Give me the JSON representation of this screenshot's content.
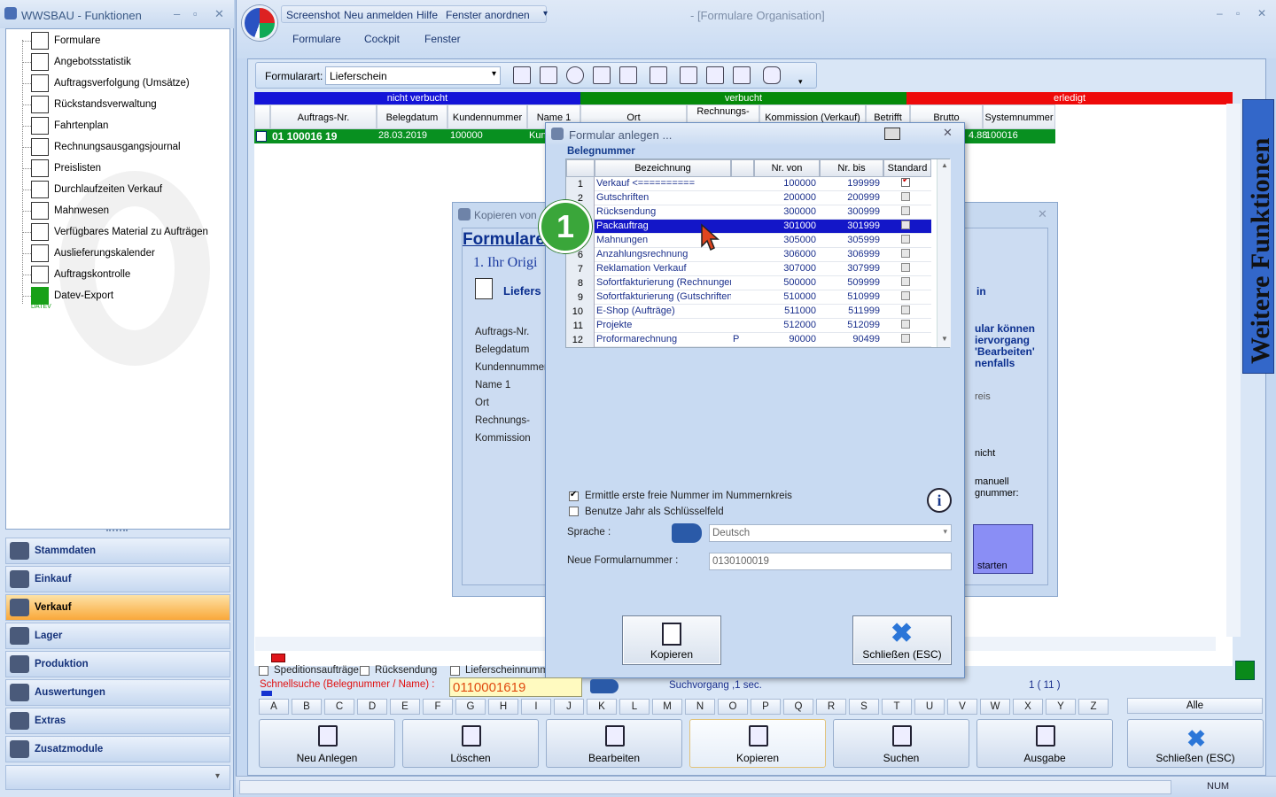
{
  "left_window": {
    "title": "WWSBAU - Funktionen",
    "tree_items": [
      {
        "label": "Formulare",
        "icon": "document-icon"
      },
      {
        "label": "Angebotsstatistik",
        "icon": "statistics-icon"
      },
      {
        "label": "Auftragsverfolgung (Umsätze)",
        "icon": "tracking-icon"
      },
      {
        "label": "Rückstandsverwaltung",
        "icon": "backlog-icon"
      },
      {
        "label": "Fahrtenplan",
        "icon": "truck-icon"
      },
      {
        "label": "Rechnungsausgangsjournal",
        "icon": "journal-icon"
      },
      {
        "label": "Preislisten",
        "icon": "price-tag-icon"
      },
      {
        "label": "Durchlaufzeiten Verkauf",
        "icon": "hourglass-icon"
      },
      {
        "label": "Mahnwesen",
        "icon": "dunning-icon"
      },
      {
        "label": "Verfügbares Material zu Aufträgen",
        "icon": "material-icon"
      },
      {
        "label": "Auslieferungskalender",
        "icon": "calendar-icon"
      },
      {
        "label": "Auftragskontrolle",
        "icon": "control-icon"
      },
      {
        "label": "Datev-Export",
        "icon": "datev-icon"
      }
    ],
    "datev_caption": "DATEV",
    "nav": [
      {
        "label": "Stammdaten",
        "selected": false
      },
      {
        "label": "Einkauf",
        "selected": false
      },
      {
        "label": "Verkauf",
        "selected": true
      },
      {
        "label": "Lager",
        "selected": false
      },
      {
        "label": "Produktion",
        "selected": false
      },
      {
        "label": "Auswertungen",
        "selected": false
      },
      {
        "label": "Extras",
        "selected": false
      },
      {
        "label": "Zusatzmodule",
        "selected": false
      }
    ]
  },
  "main_window": {
    "title": "- [Formulare Organisation]",
    "quick_access": [
      "Screenshot",
      "Neu anmelden",
      "Hilfe",
      "Fenster anordnen"
    ],
    "menu": [
      "Formulare",
      "Cockpit",
      "Fenster"
    ],
    "formularart_label": "Formularart:",
    "formularart_value": "Lieferschein",
    "bands": [
      "nicht verbucht",
      "verbucht",
      "erledigt"
    ],
    "columns": [
      "Auftrags-Nr.",
      "Belegdatum",
      "Kundennummer",
      "Name 1",
      "Ort",
      "Rechnungs-",
      "Kommission (Verkauf)",
      "Betrifft",
      "Brutto",
      "Systemnummer"
    ],
    "row": {
      "auftrag": "01 100016 19",
      "datum": "28.03.2019",
      "kunde": "100000",
      "name": "Kun",
      "brutto": "4.88",
      "system": "100016"
    }
  },
  "kopieren_window": {
    "title": "Kopieren von",
    "heading": "Formulare",
    "section": "1. Ihr Origi",
    "sub": "Liefers",
    "fields": [
      "Auftrags-Nr.",
      "Belegdatum",
      "Kundennummer",
      "Name 1",
      "Ort",
      "Rechnungs-",
      "Kommission"
    ],
    "right_texts": [
      "in",
      "ular können",
      "iervorgang",
      "'Bearbeiten'",
      "nenfalls",
      "reis",
      "nicht",
      "manuell",
      "gnummer:",
      "starten"
    ]
  },
  "dialog": {
    "title": "Formular anlegen ...",
    "section": "Belegnummer",
    "columns": [
      "Bezeichnung",
      "Nr. von",
      "Nr. bis",
      "Standard"
    ],
    "rows": [
      {
        "n": "1",
        "name": "Verkauf  <==========",
        "flag": "",
        "von": "100000",
        "bis": "199999",
        "std": true,
        "sel": false
      },
      {
        "n": "2",
        "name": "Gutschriften",
        "flag": "",
        "von": "200000",
        "bis": "200999",
        "std": false,
        "sel": false
      },
      {
        "n": "3",
        "name": "Rücksendung",
        "flag": "",
        "von": "300000",
        "bis": "300999",
        "std": false,
        "sel": false
      },
      {
        "n": "4",
        "name": "Packauftrag",
        "flag": "",
        "von": "301000",
        "bis": "301999",
        "std": false,
        "sel": true
      },
      {
        "n": "5",
        "name": "Mahnungen",
        "flag": "",
        "von": "305000",
        "bis": "305999",
        "std": false,
        "sel": false
      },
      {
        "n": "6",
        "name": "Anzahlungsrechnung",
        "flag": "",
        "von": "306000",
        "bis": "306999",
        "std": false,
        "sel": false
      },
      {
        "n": "7",
        "name": "Reklamation Verkauf",
        "flag": "",
        "von": "307000",
        "bis": "307999",
        "std": false,
        "sel": false
      },
      {
        "n": "8",
        "name": "Sofortfakturierung (Rechnungen",
        "flag": "",
        "von": "500000",
        "bis": "509999",
        "std": false,
        "sel": false
      },
      {
        "n": "9",
        "name": "Sofortfakturierung (Gutschriften)",
        "flag": "",
        "von": "510000",
        "bis": "510999",
        "std": false,
        "sel": false
      },
      {
        "n": "10",
        "name": "E-Shop (Aufträge)",
        "flag": "",
        "von": "511000",
        "bis": "511999",
        "std": false,
        "sel": false
      },
      {
        "n": "11",
        "name": "Projekte",
        "flag": "",
        "von": "512000",
        "bis": "512099",
        "std": false,
        "sel": false
      },
      {
        "n": "12",
        "name": "Proformarechnung",
        "flag": "P",
        "von": "90000",
        "bis": "90499",
        "std": false,
        "sel": false
      }
    ],
    "check1": "Ermittle erste freie Nummer im Nummernkreis",
    "check1_on": true,
    "check2": "Benutze Jahr als Schlüsselfeld",
    "check2_on": false,
    "sprache_label": "Sprache :",
    "sprache_value": "Deutsch",
    "neue_label": "Neue Formularnummer :",
    "neue_value": "0130100019",
    "btn_kopieren": "Kopieren",
    "btn_close": "Schließen (ESC)"
  },
  "badge": "1",
  "bottom": {
    "checks": [
      "Speditionsaufträge",
      "Rücksendung",
      "Lieferscheinnumme"
    ],
    "search_label": "Schnellsuche (Belegnummer / Name) :",
    "search_value": "0110001619",
    "search_status": "Suchvorgang ,1 sec.",
    "count": "1  ( 11 )",
    "letters": [
      "A",
      "B",
      "C",
      "D",
      "E",
      "F",
      "G",
      "H",
      "I",
      "J",
      "K",
      "L",
      "M",
      "N",
      "O",
      "P",
      "Q",
      "R",
      "S",
      "T",
      "U",
      "V",
      "W",
      "X",
      "Y",
      "Z"
    ],
    "alle": "Alle",
    "actions": [
      "Neu Anlegen",
      "Löschen",
      "Bearbeiten",
      "Kopieren",
      "Suchen",
      "Ausgabe",
      "Schließen (ESC)"
    ]
  },
  "side_panel": "Weitere Funktionen",
  "status": {
    "num": "NUM"
  },
  "colors": {
    "band_nicht": "#1414d8",
    "band_verbucht": "#058a0a",
    "band_erledigt": "#ee0a0a",
    "selection": "#1316c8",
    "nav_selected": "#f9a83a"
  }
}
